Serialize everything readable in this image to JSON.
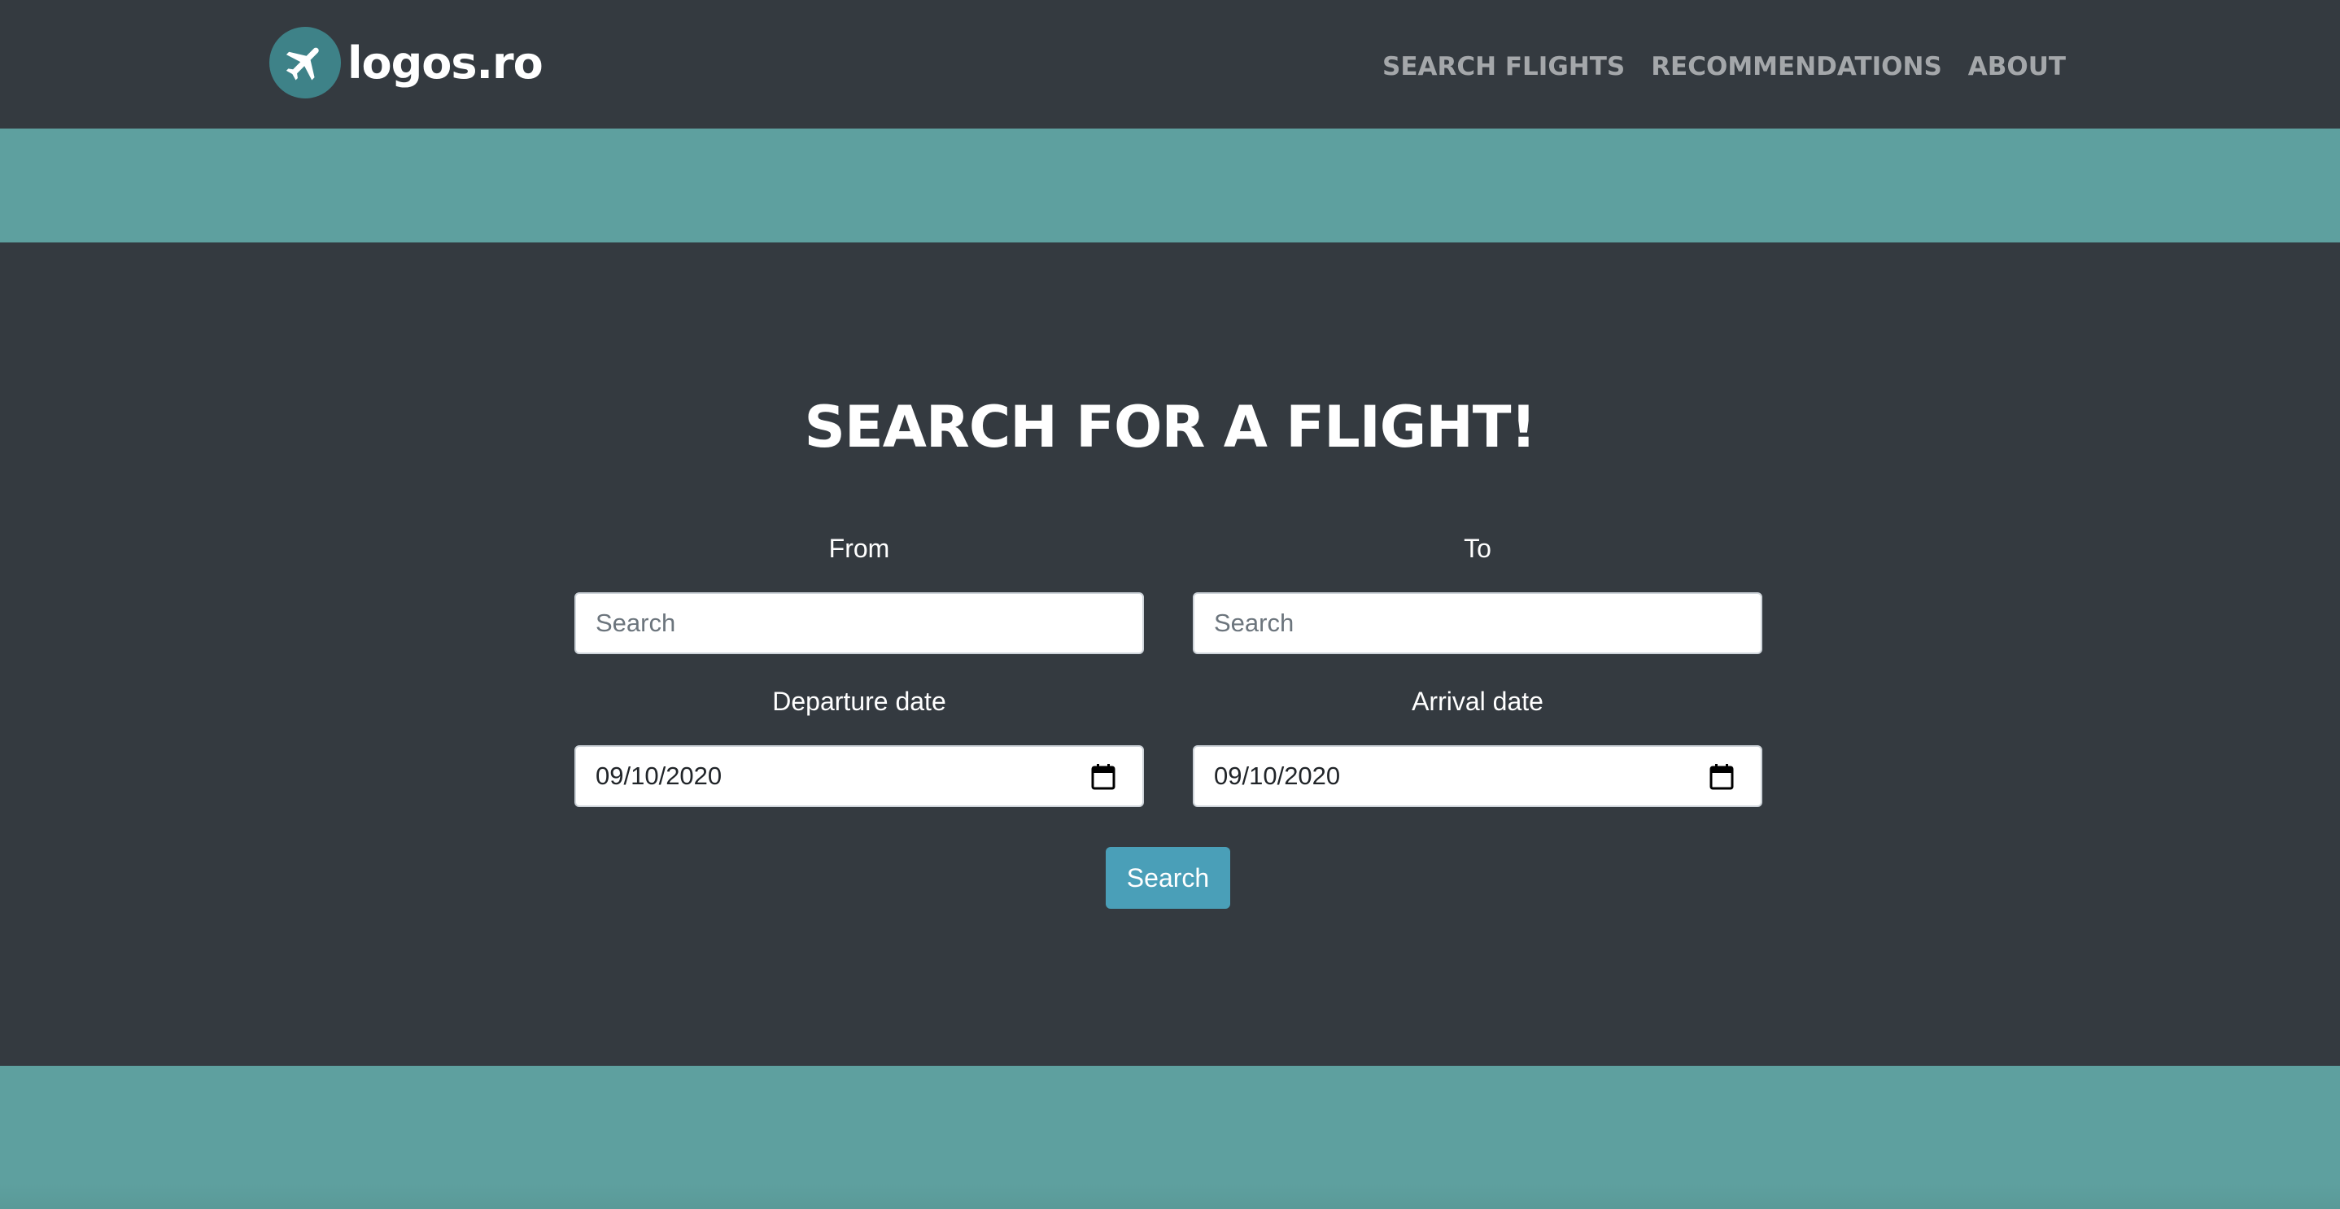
{
  "brand": {
    "name": "logos.ro",
    "logo_icon": "airplane-icon",
    "logo_color": "#3e8288"
  },
  "nav": {
    "items": [
      {
        "label": "SEARCH FLIGHTS"
      },
      {
        "label": "RECOMMENDATIONS"
      },
      {
        "label": "ABOUT"
      }
    ]
  },
  "colors": {
    "background": "#343a40",
    "band": "#5ea09f",
    "button": "#4a9fb8"
  },
  "search": {
    "title": "SEARCH FOR A FLIGHT!",
    "from": {
      "label": "From",
      "placeholder": "Search",
      "value": ""
    },
    "to": {
      "label": "To",
      "placeholder": "Search",
      "value": ""
    },
    "departure": {
      "label": "Departure date",
      "value": "09/10/2020",
      "icon": "calendar-icon"
    },
    "arrival": {
      "label": "Arrival date",
      "value": "09/10/2020",
      "icon": "calendar-icon"
    },
    "button_label": "Search"
  }
}
